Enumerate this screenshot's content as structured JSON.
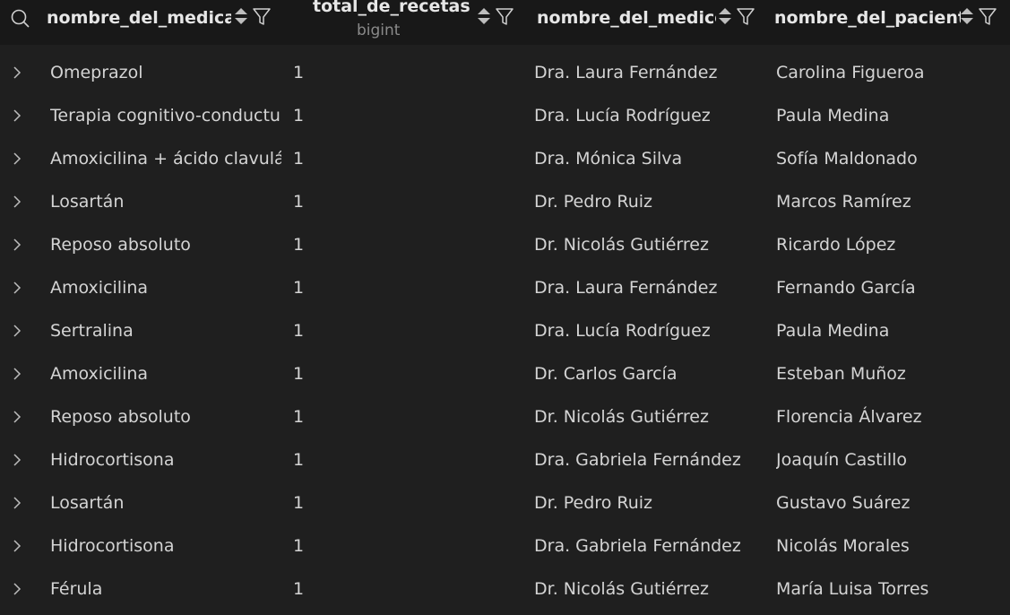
{
  "columns": [
    {
      "name": "nombre_del_medicamento",
      "type": ""
    },
    {
      "name": "total_de_recetas",
      "type": "bigint"
    },
    {
      "name": "nombre_del_medico",
      "type": ""
    },
    {
      "name": "nombre_del_paciente",
      "type": ""
    }
  ],
  "rows": [
    {
      "medicamento": "Omeprazol",
      "total": "1",
      "medico": "Dra. Laura Fernández",
      "paciente": "Carolina Figueroa"
    },
    {
      "medicamento": "Terapia cognitivo-conductual",
      "total": "1",
      "medico": "Dra. Lucía Rodríguez",
      "paciente": "Paula Medina"
    },
    {
      "medicamento": "Amoxicilina + ácido clavulánico",
      "total": "1",
      "medico": "Dra. Mónica Silva",
      "paciente": "Sofía Maldonado"
    },
    {
      "medicamento": "Losartán",
      "total": "1",
      "medico": "Dr. Pedro Ruiz",
      "paciente": "Marcos Ramírez"
    },
    {
      "medicamento": "Reposo absoluto",
      "total": "1",
      "medico": "Dr. Nicolás Gutiérrez",
      "paciente": "Ricardo López"
    },
    {
      "medicamento": "Amoxicilina",
      "total": "1",
      "medico": "Dra. Laura Fernández",
      "paciente": "Fernando García"
    },
    {
      "medicamento": "Sertralina",
      "total": "1",
      "medico": "Dra. Lucía Rodríguez",
      "paciente": "Paula Medina"
    },
    {
      "medicamento": "Amoxicilina",
      "total": "1",
      "medico": "Dr. Carlos García",
      "paciente": "Esteban Muñoz"
    },
    {
      "medicamento": "Reposo absoluto",
      "total": "1",
      "medico": "Dr. Nicolás Gutiérrez",
      "paciente": "Florencia Álvarez"
    },
    {
      "medicamento": "Hidrocortisona",
      "total": "1",
      "medico": "Dra. Gabriela Fernández",
      "paciente": "Joaquín Castillo"
    },
    {
      "medicamento": "Losartán",
      "total": "1",
      "medico": "Dr. Pedro Ruiz",
      "paciente": "Gustavo Suárez"
    },
    {
      "medicamento": "Hidrocortisona",
      "total": "1",
      "medico": "Dra. Gabriela Fernández",
      "paciente": "Nicolás Morales"
    },
    {
      "medicamento": "Férula",
      "total": "1",
      "medico": "Dr. Nicolás Gutiérrez",
      "paciente": "María Luisa Torres"
    }
  ]
}
